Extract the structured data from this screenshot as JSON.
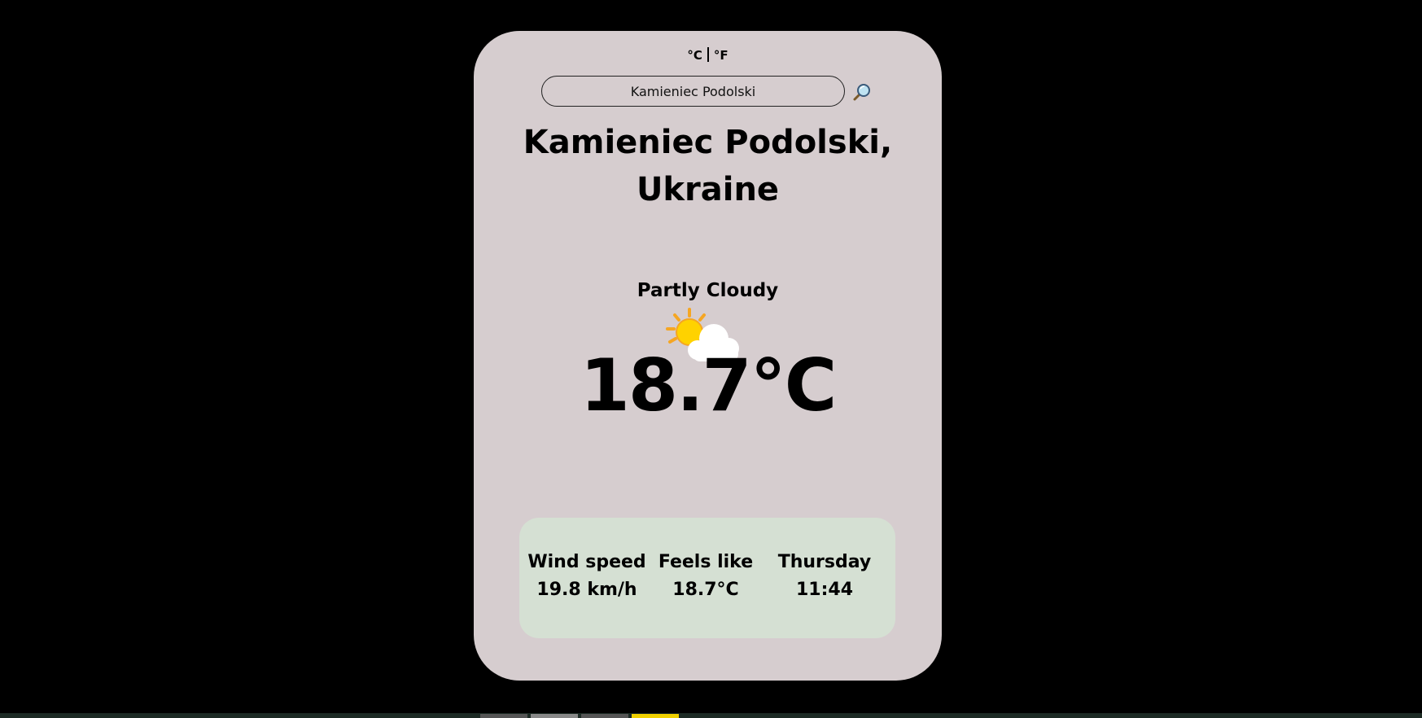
{
  "units": {
    "celsius": "°C",
    "fahrenheit": "°F"
  },
  "search": {
    "value": "Kamieniec Podolski",
    "icon": "magnifier-icon"
  },
  "location": {
    "city_line": "Kamieniec Podolski,",
    "country_line": "Ukraine"
  },
  "condition": {
    "text": "Partly Cloudy",
    "icon": "partly-cloudy-icon"
  },
  "temperature": {
    "value": "18.7°C"
  },
  "details": {
    "wind": {
      "label": "Wind speed",
      "value": "19.8 km/h"
    },
    "feels": {
      "label": "Feels like",
      "value": "18.7°C"
    },
    "day": {
      "label": "Thursday",
      "value": "11:44"
    }
  },
  "colors": {
    "page_bg": "#000000",
    "card_bg": "#d6cdcf",
    "details_bg": "#d5e0d3",
    "taskbar_highlight": "#f0d000"
  }
}
